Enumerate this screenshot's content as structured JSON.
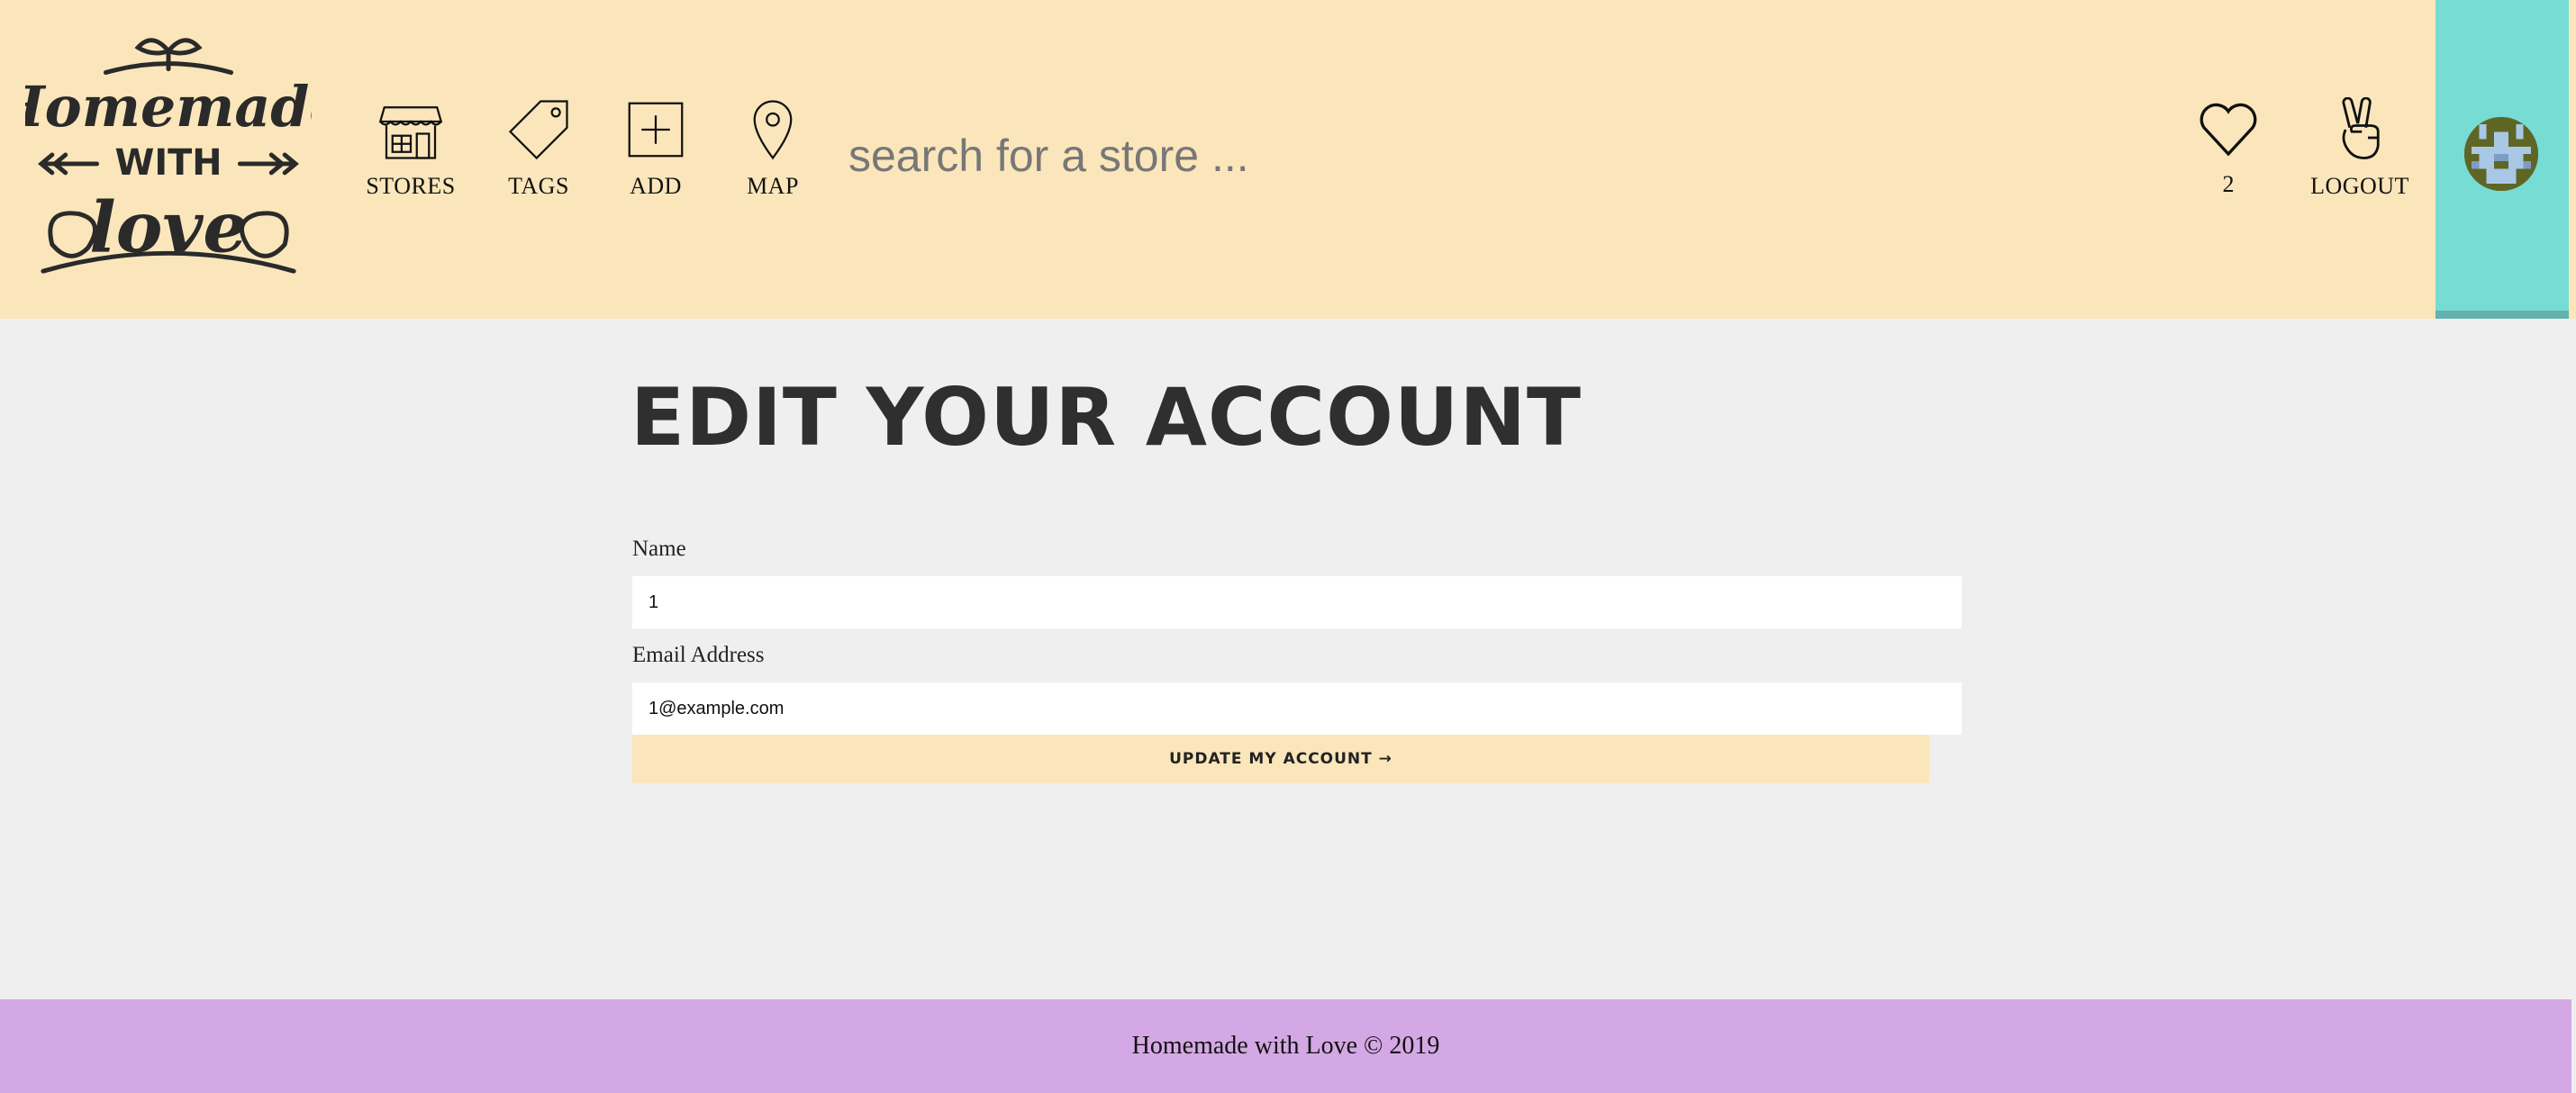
{
  "header": {
    "logo_text": "Homemade WITH love",
    "nav": [
      {
        "label": "STORES",
        "icon": "store-icon"
      },
      {
        "label": "TAGS",
        "icon": "tag-icon"
      },
      {
        "label": "ADD",
        "icon": "add-icon"
      },
      {
        "label": "MAP",
        "icon": "map-pin-icon"
      }
    ],
    "search_placeholder": "search for a store ...",
    "hearts": {
      "count": "2",
      "icon": "heart-icon"
    },
    "logout": {
      "label": "LOGOUT",
      "icon": "peace-hand-icon"
    },
    "avatar_panel_color": "#77dcd3"
  },
  "main": {
    "title": "EDIT YOUR ACCOUNT",
    "name_label": "Name",
    "name_value": "1",
    "email_label": "Email Address",
    "email_value": "1@example.com",
    "submit_label": "UPDATE MY ACCOUNT →"
  },
  "footer": {
    "text": "Homemade with Love © 2019"
  },
  "colors": {
    "header_bg": "#fbe6bb",
    "page_bg": "#efefef",
    "footer_bg": "#d4a8e4",
    "avatar_panel": "#77dcd3",
    "title": "#2f2f2f"
  }
}
